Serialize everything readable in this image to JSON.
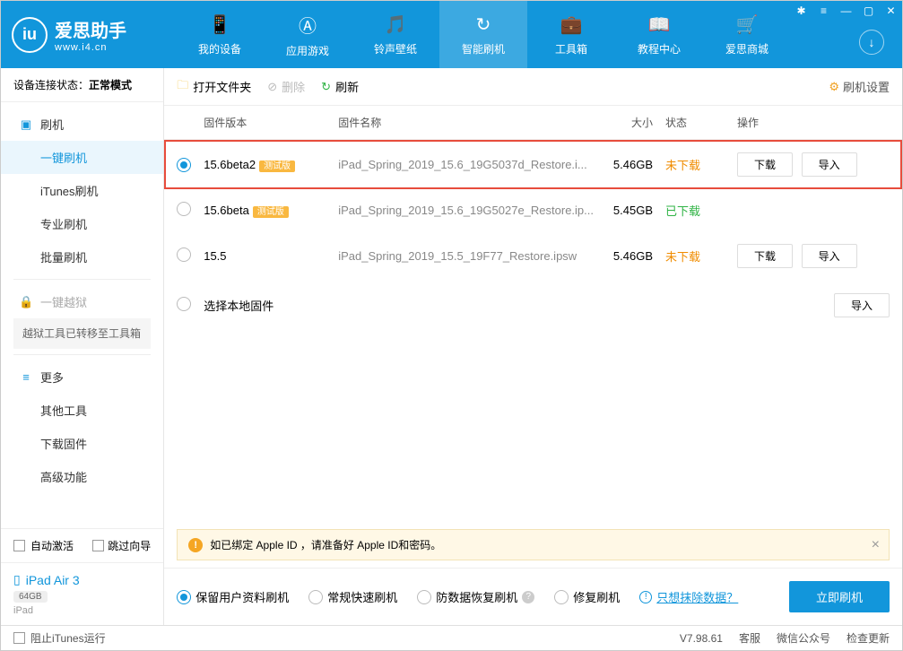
{
  "logo": {
    "title": "爱思助手",
    "sub": "www.i4.cn",
    "badge": "iu"
  },
  "nav": [
    {
      "label": "我的设备",
      "icon": "📱"
    },
    {
      "label": "应用游戏",
      "icon": "Ⓐ"
    },
    {
      "label": "铃声壁纸",
      "icon": "🎵"
    },
    {
      "label": "智能刷机",
      "icon": "↻",
      "active": true
    },
    {
      "label": "工具箱",
      "icon": "💼"
    },
    {
      "label": "教程中心",
      "icon": "📖"
    },
    {
      "label": "爱思商城",
      "icon": "🛒"
    }
  ],
  "conn": {
    "label": "设备连接状态：",
    "value": "正常模式"
  },
  "sidebar": {
    "flash": {
      "label": "刷机"
    },
    "items": [
      "一键刷机",
      "iTunes刷机",
      "专业刷机",
      "批量刷机"
    ],
    "jailbreak": "一键越狱",
    "jailbreak_note": "越狱工具已转移至工具箱",
    "more": "更多",
    "more_items": [
      "其他工具",
      "下载固件",
      "高级功能"
    ],
    "auto_activate": "自动激活",
    "skip_guide": "跳过向导",
    "device": {
      "name": "iPad Air 3",
      "storage": "64GB",
      "type": "iPad"
    }
  },
  "toolbar": {
    "open": "打开文件夹",
    "delete": "删除",
    "refresh": "刷新",
    "settings": "刷机设置"
  },
  "table": {
    "headers": {
      "version": "固件版本",
      "name": "固件名称",
      "size": "大小",
      "status": "状态",
      "ops": "操作"
    },
    "rows": [
      {
        "selected": true,
        "version": "15.6beta2",
        "beta": "测试版",
        "name": "iPad_Spring_2019_15.6_19G5037d_Restore.i...",
        "size": "5.46GB",
        "status": "未下载",
        "status_class": "orange",
        "download": "下载",
        "import": "导入",
        "highlighted": true
      },
      {
        "selected": false,
        "version": "15.6beta",
        "beta": "测试版",
        "name": "iPad_Spring_2019_15.6_19G5027e_Restore.ip...",
        "size": "5.45GB",
        "status": "已下载",
        "status_class": "green"
      },
      {
        "selected": false,
        "version": "15.5",
        "name": "iPad_Spring_2019_15.5_19F77_Restore.ipsw",
        "size": "5.46GB",
        "status": "未下载",
        "status_class": "orange",
        "download": "下载",
        "import": "导入"
      },
      {
        "selected": false,
        "version": "选择本地固件",
        "local": true,
        "import": "导入"
      }
    ]
  },
  "alert": "如已绑定 Apple ID ，请准备好 Apple ID和密码。",
  "flash_opts": {
    "keep": "保留用户资料刷机",
    "normal": "常规快速刷机",
    "anti": "防数据恢复刷机",
    "repair": "修复刷机",
    "erase": "只想抹除数据？",
    "go": "立即刷机"
  },
  "footer": {
    "block_itunes": "阻止iTunes运行",
    "version": "V7.98.61",
    "support": "客服",
    "wechat": "微信公众号",
    "update": "检查更新"
  }
}
